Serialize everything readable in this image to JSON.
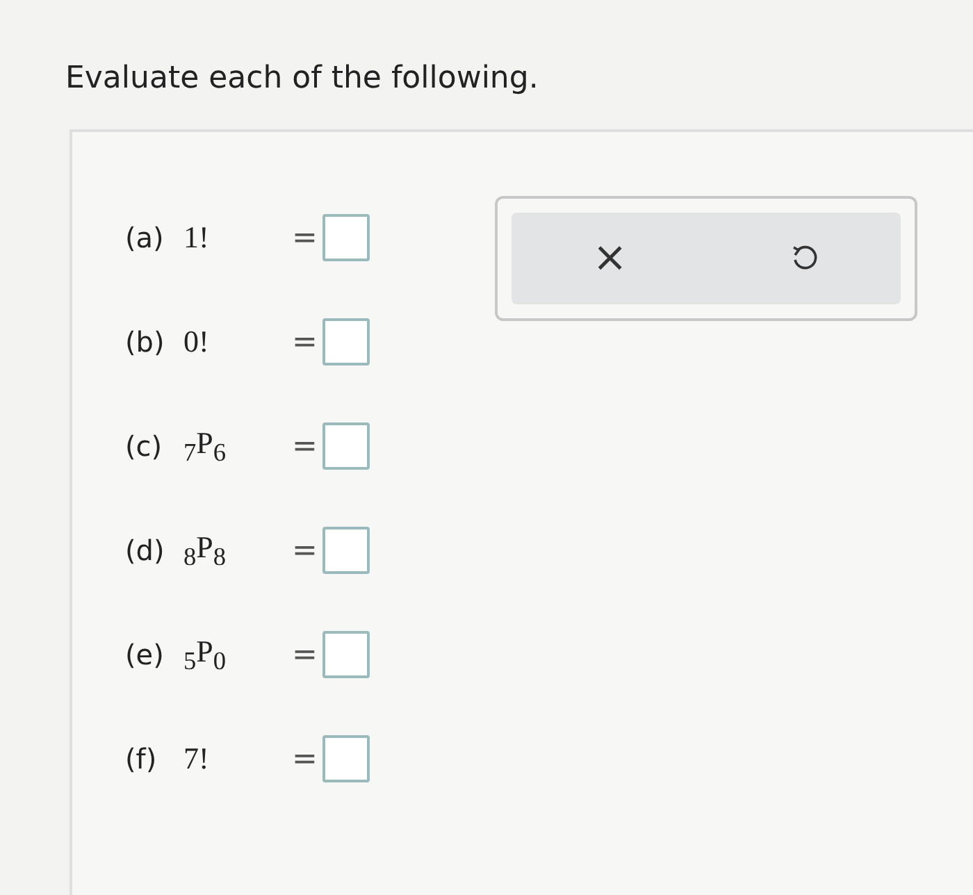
{
  "instruction": "Evaluate each of the following.",
  "problems": [
    {
      "label": "(a)",
      "expression": "1!",
      "relation": "="
    },
    {
      "label": "(b)",
      "expression": "0!",
      "relation": "="
    },
    {
      "label": "(c)",
      "expression": "$_{7}$P$_{6}$",
      "relation": "="
    },
    {
      "label": "(d)",
      "expression": "$_{8}$P$_{8}$",
      "relation": "="
    },
    {
      "label": "(e)",
      "expression": "$_{5}$P$_{0}$",
      "relation": "="
    },
    {
      "label": "(f)",
      "expression": "7!",
      "relation": "="
    }
  ],
  "tools": {
    "clear": "×"
  }
}
